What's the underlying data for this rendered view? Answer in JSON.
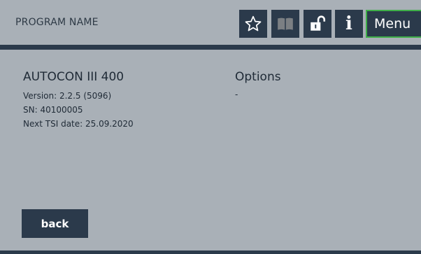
{
  "header": {
    "program_name": "PROGRAM NAME",
    "menu_label": "Menu",
    "icons": [
      "star-icon",
      "book-icon",
      "unlock-icon",
      "info-icon"
    ]
  },
  "device": {
    "title": "AUTOCON III 400",
    "version": "Version: 2.2.5 (5096)",
    "serial": "SN: 40100005",
    "next_tsi": "Next TSI date: 25.09.2020"
  },
  "options": {
    "title": "Options",
    "value": "-"
  },
  "footer": {
    "back_label": "back"
  },
  "colors": {
    "background": "#a9b0b7",
    "dark": "#2b3a4b",
    "menu_border": "#3fae49"
  }
}
